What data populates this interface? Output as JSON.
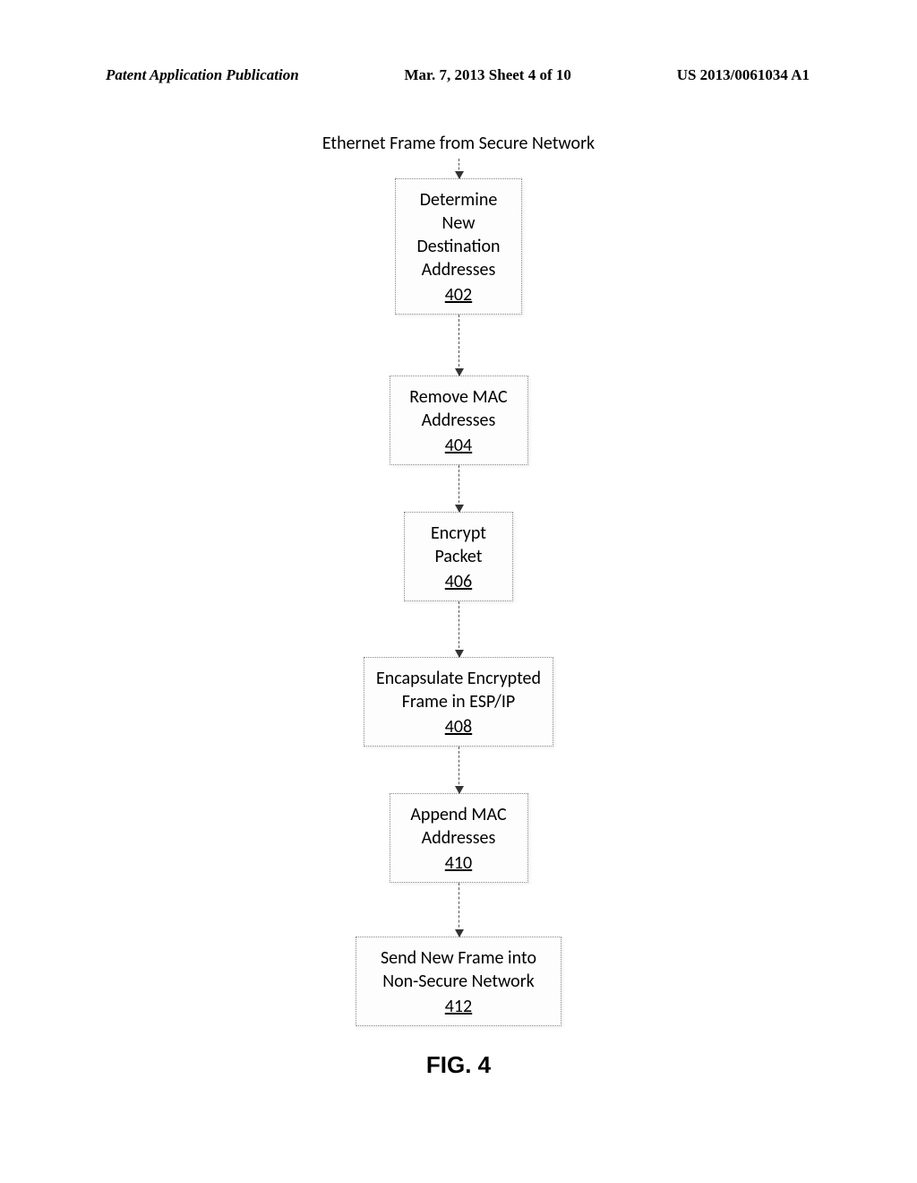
{
  "header": {
    "left": "Patent Application Publication",
    "center": "Mar. 7, 2013  Sheet 4 of 10",
    "right": "US 2013/0061034 A1"
  },
  "chart_data": {
    "type": "flowchart",
    "input": "Ethernet Frame from Secure Network",
    "steps": [
      {
        "id": "402",
        "text": "Determine New Destination Addresses",
        "ref": "402"
      },
      {
        "id": "404",
        "text": "Remove MAC Addresses",
        "ref": "404"
      },
      {
        "id": "406",
        "text": "Encrypt Packet",
        "ref": "406"
      },
      {
        "id": "408",
        "text": "Encapsulate Encrypted Frame in ESP/IP",
        "ref": "408"
      },
      {
        "id": "410",
        "text": "Append MAC Addresses",
        "ref": "410"
      },
      {
        "id": "412",
        "text": "Send New Frame into Non-Secure Network",
        "ref": "412"
      }
    ],
    "figure_label": "FIG. 4"
  }
}
